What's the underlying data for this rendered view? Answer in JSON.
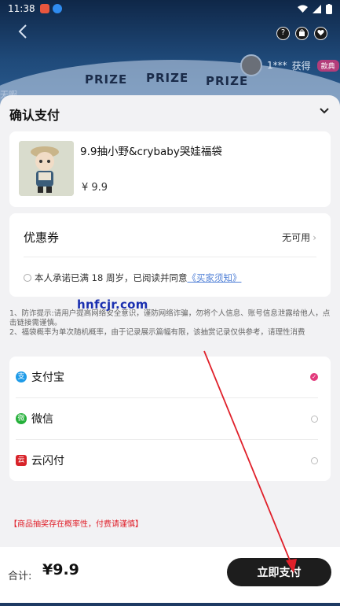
{
  "status_bar": {
    "time": "11:38"
  },
  "background": {
    "prize_words": [
      "PRIZE",
      "PRIZE",
      "PRIZE"
    ],
    "winner_name": "1***",
    "winner_action": "获得",
    "winner_tag": "款典",
    "side_text": "无暇"
  },
  "sheet": {
    "title": "确认支付",
    "product": {
      "name": "9.9抽小野&crybaby哭娃福袋",
      "price": "¥ 9.9"
    },
    "coupon": {
      "label": "优惠券",
      "value": "无可用",
      "chevron": "›"
    },
    "agreement": {
      "text": "本人承诺已满 18 周岁，已阅读并同意",
      "link": "《买家须知》"
    },
    "notice": {
      "line1": "1、防诈提示:请用户提高网络安全意识，谨防网络诈骗，勿将个人信息、账号信息泄露给他人，点击链接需谨慎。",
      "line2": "2、福袋概率为单次随机概率，由于记录展示篇幅有限，该抽赏记录仅供参考，请理性消费"
    },
    "payment_methods": [
      {
        "label": "支付宝",
        "selected": true,
        "icon": "alipay-icon",
        "color": "#1e9be8"
      },
      {
        "label": "微信",
        "selected": false,
        "icon": "wechat-icon",
        "color": "#25b03a"
      },
      {
        "label": "云闪付",
        "selected": false,
        "icon": "unionpay-icon",
        "color": "#d8232a"
      }
    ],
    "risk_note": "【商品抽奖存在概率性，付费请谨慎】",
    "total_label": "合计:",
    "total_value": "¥9.9",
    "pay_button": "立即支付"
  },
  "watermark": "hnfcjr.com",
  "colors": {
    "accent": "#e23b7c",
    "button": "#1d1d1d",
    "risk": "#e0202a",
    "link": "#4f7fd6",
    "annotation_arrow": "#e0202a"
  }
}
